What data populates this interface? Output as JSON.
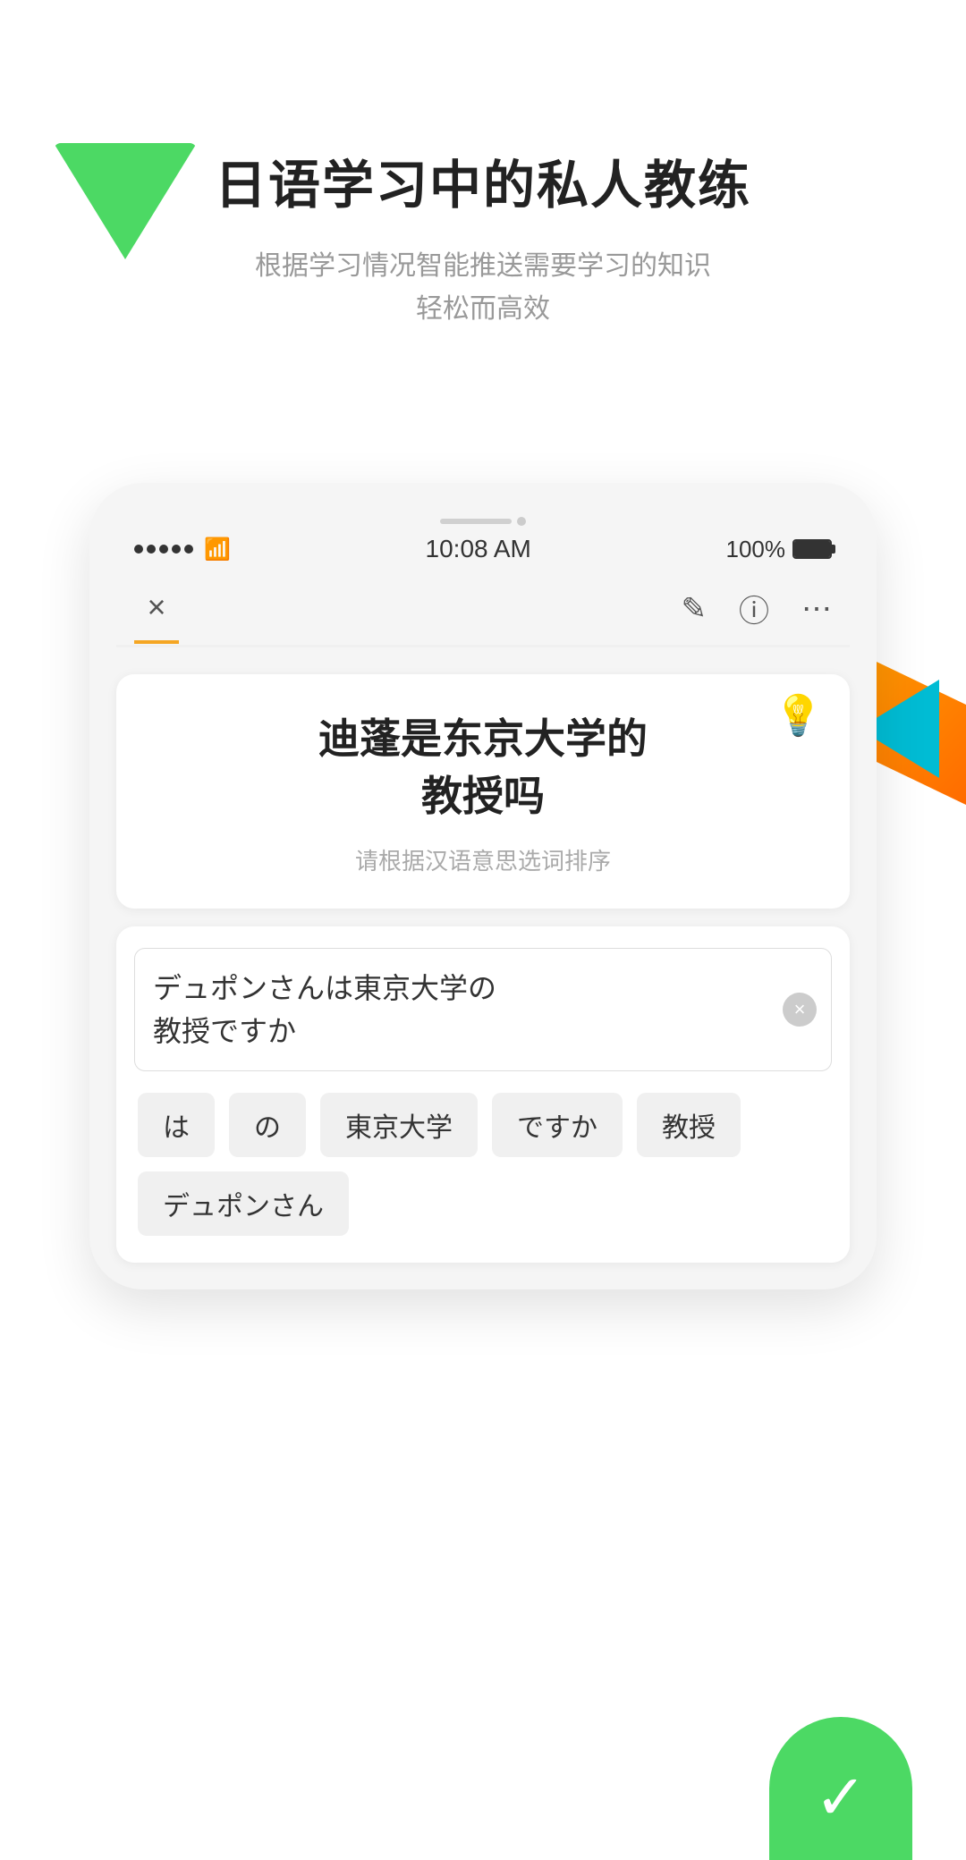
{
  "app": {
    "main_title": "日语学习中的私人教练",
    "sub_title_line1": "根据学习情况智能推送需要学习的知识",
    "sub_title_line2": "轻松而高效"
  },
  "status_bar": {
    "time": "10:08 AM",
    "battery": "100%"
  },
  "nav": {
    "close_icon": "×",
    "edit_icon": "✎",
    "help_icon": "?",
    "more_icon": "···"
  },
  "question": {
    "text_line1": "迪蓬是东京大学的",
    "text_line2": "教授吗",
    "hint": "请根据汉语意思选词排序",
    "lightbulb_icon": "💡"
  },
  "answer": {
    "input_text_line1": "デュポンさんは東京大学の",
    "input_text_line2": "教授ですか",
    "clear_icon": "×"
  },
  "chips": [
    {
      "label": "は"
    },
    {
      "label": "の"
    },
    {
      "label": "東京大学"
    },
    {
      "label": "ですか"
    },
    {
      "label": "教授"
    },
    {
      "label": "デュポンさん"
    }
  ],
  "colors": {
    "green": "#4cd964",
    "orange": "#ff9500",
    "teal": "#00bcd4",
    "accent_yellow": "#f5a623"
  }
}
